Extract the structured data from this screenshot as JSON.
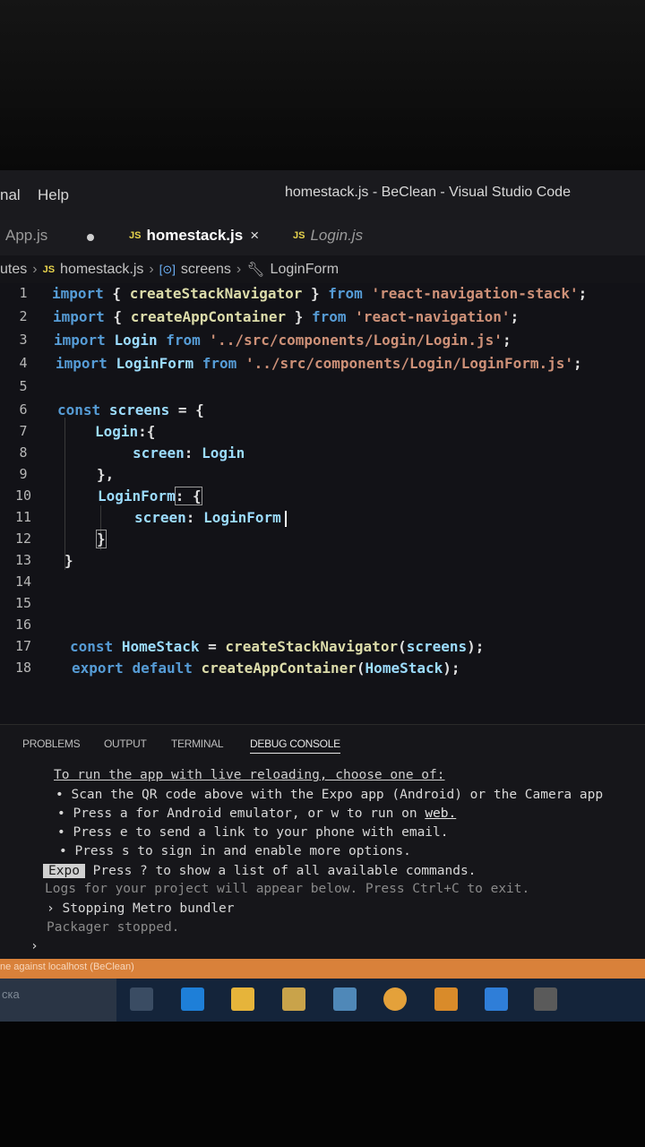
{
  "menu": {
    "terminal_partial": "nal",
    "help": "Help"
  },
  "window_title": "homestack.js - BeClean - Visual Studio Code",
  "tabs": [
    {
      "label": "App.js",
      "badge": ""
    },
    {
      "label": "homestack.js",
      "badge": "JS",
      "close": "×"
    },
    {
      "label": "Login.js",
      "badge": "JS"
    }
  ],
  "breadcrumb": {
    "folder": "utes",
    "file_badge": "JS",
    "file": "homestack.js",
    "symbol_icon": "[⊙]",
    "symbol": "screens",
    "member": "LoginForm"
  },
  "code_lines": [
    {
      "n": "1",
      "text": "import { createStackNavigator } from 'react-navigation-stack';"
    },
    {
      "n": "2",
      "text": "import { createAppContainer } from 'react-navigation';"
    },
    {
      "n": "3",
      "text": "import Login from '../src/components/Login/Login.js';"
    },
    {
      "n": "4",
      "text": "import LoginForm from '../src/components/Login/LoginForm.js';"
    },
    {
      "n": "5",
      "text": ""
    },
    {
      "n": "6",
      "text": "const screens = {"
    },
    {
      "n": "7",
      "text": "Login:{"
    },
    {
      "n": "8",
      "text": "screen: Login"
    },
    {
      "n": "9",
      "text": "},"
    },
    {
      "n": "10",
      "text": "LoginForm: {"
    },
    {
      "n": "11",
      "text": "screen: LoginForm"
    },
    {
      "n": "12",
      "text": "}"
    },
    {
      "n": "13",
      "text": "}"
    },
    {
      "n": "14",
      "text": ""
    },
    {
      "n": "15",
      "text": ""
    },
    {
      "n": "16",
      "text": ""
    },
    {
      "n": "17",
      "text": "const HomeStack = createStackNavigator(screens);"
    },
    {
      "n": "18",
      "text": "export default createAppContainer(HomeStack);"
    }
  ],
  "panel_tabs": [
    "PROBLEMS",
    "OUTPUT",
    "TERMINAL",
    "DEBUG CONSOLE"
  ],
  "terminal": {
    "header": "To run the app with live reloading, choose one of:",
    "bullets": [
      "• Scan the QR code above with the Expo app (Android) or the Camera app",
      "• Press a for Android emulator, or w to run on",
      "• Press e to send a link to your phone with email.",
      "• Press s to sign in and enable more options."
    ],
    "web_link": "web.",
    "expo_badge": "Expo",
    "expo_line": " Press ? to show a list of all available commands.",
    "logs_line": "Logs for your project will appear below. Press Ctrl+C to exit.",
    "stopping": "› Stopping Metro bundler",
    "stopped": "Packager stopped.",
    "prompt": "›"
  },
  "status_bar": "ne against localhost (BeClean)",
  "taskbar": {
    "search_text": "ска"
  }
}
